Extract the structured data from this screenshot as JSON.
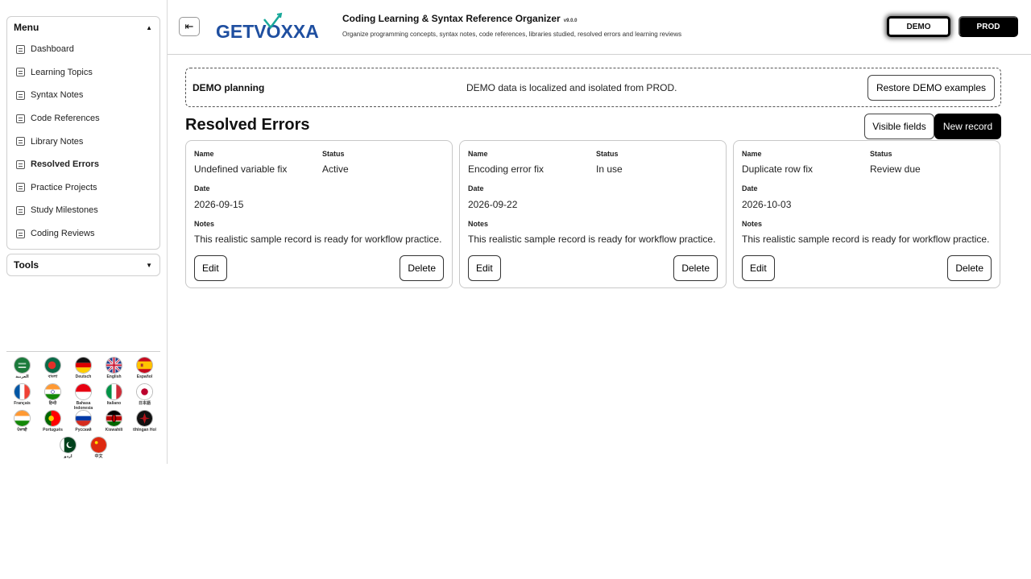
{
  "app": {
    "logo_text": "GETVOXXA",
    "title": "Coding Learning & Syntax Reference Organizer",
    "version": "v9.0.0",
    "subtitle": "Organize programming concepts, syntax notes, code references, libraries studied, resolved errors and learning reviews",
    "collapse_icon": "sidebar-collapse-icon"
  },
  "env": {
    "demo_label": "DEMO",
    "prod_label": "PROD",
    "active": "DEMO"
  },
  "sidebar": {
    "menu_title": "Menu",
    "tools_title": "Tools",
    "items": [
      {
        "label": "Dashboard",
        "active": false
      },
      {
        "label": "Learning Topics",
        "active": false
      },
      {
        "label": "Syntax Notes",
        "active": false
      },
      {
        "label": "Code References",
        "active": false
      },
      {
        "label": "Library Notes",
        "active": false
      },
      {
        "label": "Resolved Errors",
        "active": true
      },
      {
        "label": "Practice Projects",
        "active": false
      },
      {
        "label": "Study Milestones",
        "active": false
      },
      {
        "label": "Coding Reviews",
        "active": false
      }
    ],
    "languages": [
      {
        "label": "العربية",
        "flag": "sa"
      },
      {
        "label": "বাংলা",
        "flag": "bd"
      },
      {
        "label": "Deutsch",
        "flag": "de"
      },
      {
        "label": "English",
        "flag": "gb"
      },
      {
        "label": "Español",
        "flag": "es"
      },
      {
        "label": "Français",
        "flag": "fr"
      },
      {
        "label": "हिन्दी",
        "flag": "in"
      },
      {
        "label": "Bahasa Indonesia",
        "flag": "id"
      },
      {
        "label": "Italiano",
        "flag": "it"
      },
      {
        "label": "日本語",
        "flag": "jp"
      },
      {
        "label": "ਪੰਜਾਬੀ",
        "flag": "in"
      },
      {
        "label": "Português",
        "flag": "pt"
      },
      {
        "label": "Русский",
        "flag": "ru"
      },
      {
        "label": "Kiswahili",
        "flag": "ke"
      },
      {
        "label": "tlhIngan Hol",
        "flag": "kl"
      },
      {
        "label": "اردو",
        "flag": "pk"
      },
      {
        "label": "中文",
        "flag": "cn"
      }
    ]
  },
  "banner": {
    "title": "DEMO planning",
    "message": "DEMO data is localized and isolated from PROD.",
    "restore_label": "Restore DEMO examples"
  },
  "section": {
    "title": "Resolved Errors",
    "visible_fields_label": "Visible fields",
    "new_record_label": "New record"
  },
  "labels": {
    "name": "Name",
    "status": "Status",
    "date": "Date",
    "notes": "Notes",
    "edit": "Edit",
    "delete": "Delete"
  },
  "records": [
    {
      "name": "Undefined variable fix",
      "status": "Active",
      "date": "2026-09-15",
      "notes": "This realistic sample record is ready for workflow practice."
    },
    {
      "name": "Encoding error fix",
      "status": "In use",
      "date": "2026-09-22",
      "notes": "This realistic sample record is ready for workflow practice."
    },
    {
      "name": "Duplicate row fix",
      "status": "Review due",
      "date": "2026-10-03",
      "notes": "This realistic sample record is ready for workflow practice."
    }
  ],
  "colors": {
    "accent": "#000000",
    "logo_blue": "#1f4fa0",
    "logo_teal": "#18a89a"
  }
}
